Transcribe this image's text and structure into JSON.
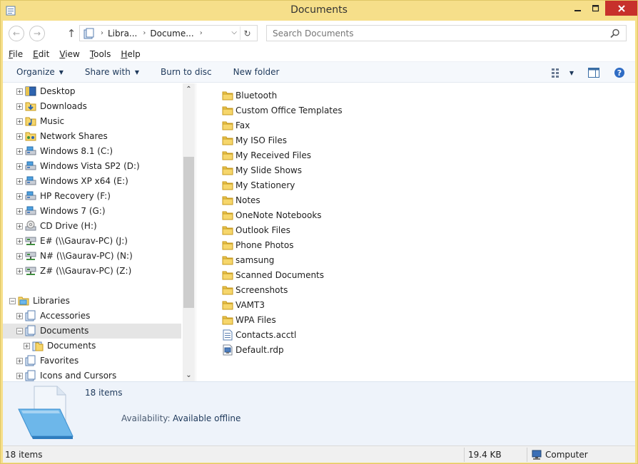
{
  "window": {
    "title": "Documents",
    "minimize_icon": "minimize-icon",
    "maximize_icon": "maximize-icon",
    "close_icon": "close-icon"
  },
  "address": {
    "segments": [
      "Libra...",
      "Docume..."
    ],
    "search_placeholder": "Search Documents"
  },
  "menu": {
    "items": [
      {
        "ul": "F",
        "rest": "ile"
      },
      {
        "ul": "E",
        "rest": "dit"
      },
      {
        "ul": "V",
        "rest": "iew"
      },
      {
        "ul": "T",
        "rest": "ools"
      },
      {
        "ul": "H",
        "rest": "elp"
      }
    ]
  },
  "toolbar": {
    "organize": "Organize",
    "share_with": "Share with",
    "burn": "Burn to disc",
    "new_folder": "New folder"
  },
  "nav": {
    "items": [
      {
        "label": "Desktop",
        "icon": "desktop-icon"
      },
      {
        "label": "Downloads",
        "icon": "downloads-icon"
      },
      {
        "label": "Music",
        "icon": "music-icon"
      },
      {
        "label": "Network Shares",
        "icon": "network-shares-icon"
      },
      {
        "label": "Windows 8.1 (C:)",
        "icon": "drive-icon"
      },
      {
        "label": "Windows Vista SP2 (D:)",
        "icon": "drive-icon"
      },
      {
        "label": "Windows XP x64 (E:)",
        "icon": "drive-icon"
      },
      {
        "label": "HP Recovery (F:)",
        "icon": "drive-icon"
      },
      {
        "label": "Windows 7 (G:)",
        "icon": "drive-icon"
      },
      {
        "label": "CD Drive (H:)",
        "icon": "cd-drive-icon"
      },
      {
        "label": "E# (\\\\Gaurav-PC) (J:)",
        "icon": "network-drive-icon"
      },
      {
        "label": "N# (\\\\Gaurav-PC) (N:)",
        "icon": "network-drive-icon"
      },
      {
        "label": "Z# (\\\\Gaurav-PC) (Z:)",
        "icon": "network-drive-icon"
      }
    ],
    "libraries_label": "Libraries",
    "library_items": [
      {
        "label": "Accessories"
      },
      {
        "label": "Documents"
      },
      {
        "label": "Documents"
      },
      {
        "label": "Favorites"
      },
      {
        "label": "Icons and Cursors"
      }
    ]
  },
  "files": [
    {
      "name": "Bluetooth",
      "type": "folder"
    },
    {
      "name": "Custom Office Templates",
      "type": "folder"
    },
    {
      "name": "Fax",
      "type": "folder"
    },
    {
      "name": "My ISO Files",
      "type": "folder"
    },
    {
      "name": "My Received Files",
      "type": "folder"
    },
    {
      "name": "My Slide Shows",
      "type": "folder"
    },
    {
      "name": "My Stationery",
      "type": "folder"
    },
    {
      "name": "Notes",
      "type": "folder"
    },
    {
      "name": "OneNote Notebooks",
      "type": "folder"
    },
    {
      "name": "Outlook Files",
      "type": "folder"
    },
    {
      "name": "Phone Photos",
      "type": "folder"
    },
    {
      "name": "samsung",
      "type": "folder"
    },
    {
      "name": "Scanned Documents",
      "type": "folder"
    },
    {
      "name": "Screenshots",
      "type": "folder"
    },
    {
      "name": "VAMT3",
      "type": "folder"
    },
    {
      "name": "WPA Files",
      "type": "folder"
    },
    {
      "name": "Contacts.acctl",
      "type": "document"
    },
    {
      "name": "Default.rdp",
      "type": "rdp"
    }
  ],
  "details": {
    "count": "18 items",
    "availability_label": "Availability:",
    "availability_value": "Available offline"
  },
  "status": {
    "count": "18 items",
    "size": "19.4 KB",
    "location": "Computer"
  }
}
